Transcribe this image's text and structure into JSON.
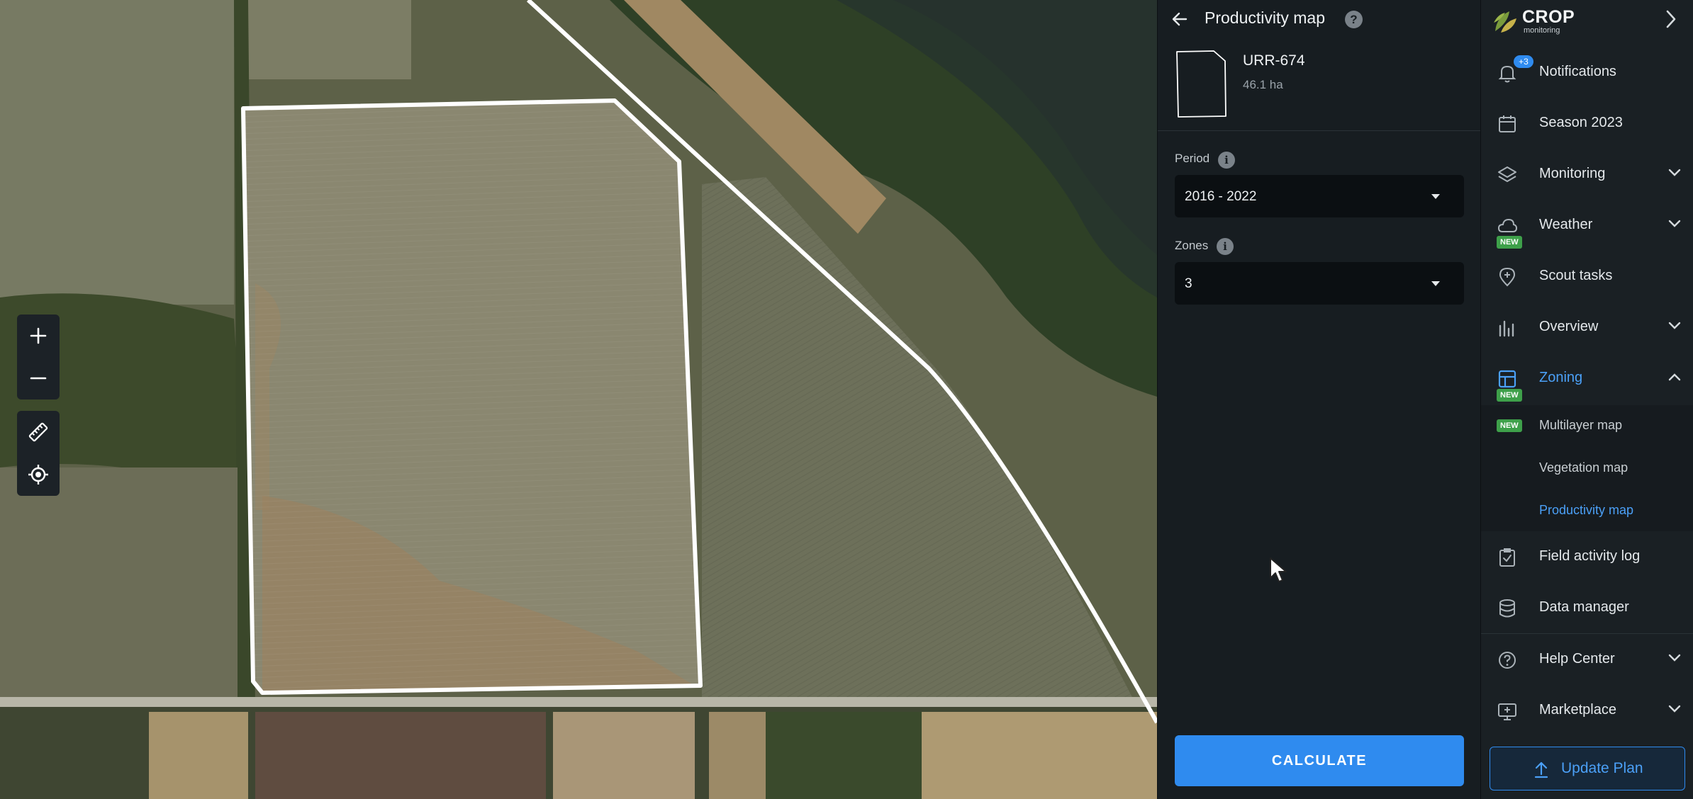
{
  "map": {
    "controls": {
      "zoom_in": "+",
      "zoom_out": "−"
    }
  },
  "panel": {
    "title": "Productivity map",
    "help": "?",
    "field": {
      "name": "URR-674",
      "area": "46.1 ha"
    },
    "period": {
      "label": "Period",
      "value": "2016 - 2022"
    },
    "zones": {
      "label": "Zones",
      "value": "3"
    },
    "info": "i",
    "calculate_label": "CALCULATE"
  },
  "sidebar": {
    "brand": {
      "name": "CROP",
      "sub": "monitoring"
    },
    "notifications_count": "+3",
    "new_badge": "NEW",
    "items": [
      {
        "label": "Notifications",
        "icon": "bell-icon"
      },
      {
        "label": "Season 2023",
        "icon": "calendar-icon"
      },
      {
        "label": "Monitoring",
        "icon": "layers-icon"
      },
      {
        "label": "Weather",
        "icon": "cloud-icon"
      },
      {
        "label": "Scout tasks",
        "icon": "map-pin-plus-icon"
      },
      {
        "label": "Overview",
        "icon": "bar-chart-icon"
      },
      {
        "label": "Zoning",
        "icon": "zoning-icon"
      },
      {
        "label": "Field activity log",
        "icon": "clipboard-check-icon"
      },
      {
        "label": "Data manager",
        "icon": "database-icon"
      },
      {
        "label": "Help Center",
        "icon": "question-circle-icon"
      },
      {
        "label": "Marketplace",
        "icon": "marketplace-icon"
      }
    ],
    "zoning_sub": [
      {
        "label": "Multilayer map"
      },
      {
        "label": "Vegetation map"
      },
      {
        "label": "Productivity map"
      }
    ],
    "update_plan_label": "Update Plan"
  },
  "colors": {
    "accent": "#2f8bef",
    "active_text": "#4ba0f7",
    "new_badge": "#3ea04a",
    "panel_bg": "#171d21",
    "sidebar_bg": "#1a2024"
  }
}
